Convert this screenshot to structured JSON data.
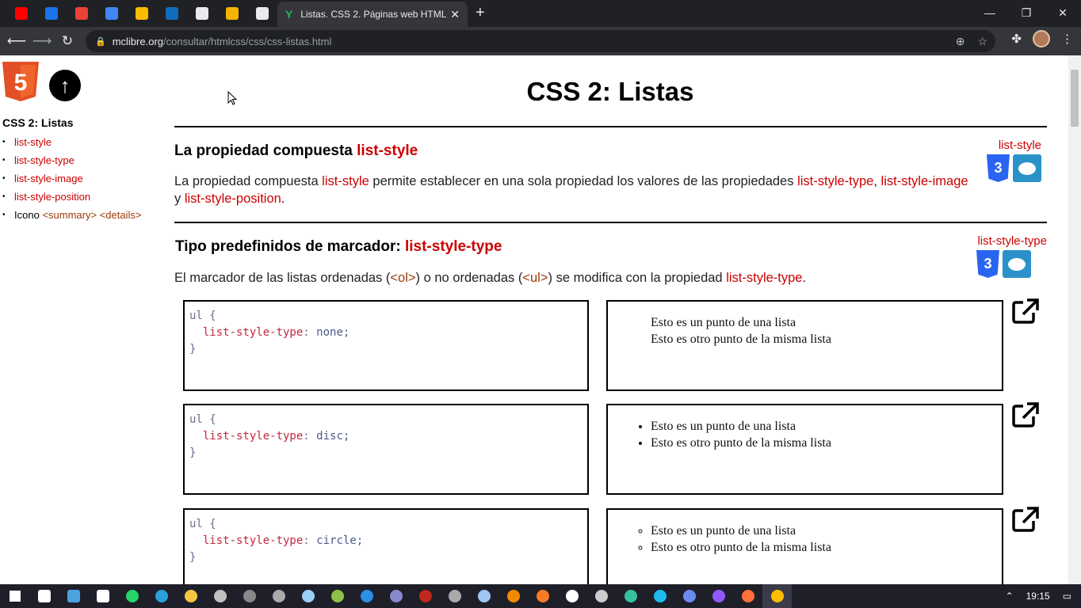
{
  "browser": {
    "pinned_tabs": [
      {
        "name": "youtube-tab",
        "color": "#ff0000"
      },
      {
        "name": "tab-app-2",
        "color": "#1a73e8"
      },
      {
        "name": "gmail-tab",
        "color": "#ea4335"
      },
      {
        "name": "calendar-tab",
        "color": "#4285f4"
      },
      {
        "name": "drive-tab",
        "color": "#fbbc04"
      },
      {
        "name": "mail-tab",
        "color": "#0f6cbd"
      },
      {
        "name": "tab-app-7",
        "color": "#e8eaed"
      },
      {
        "name": "tab-app-8",
        "color": "#f4b400"
      },
      {
        "name": "bookmark-tab",
        "color": "#e8eaed"
      }
    ],
    "active_tab_title": "Listas. CSS 2. Páginas web HTML",
    "active_tab_favicon": "Y",
    "url_domain": "mclibre.org",
    "url_path": "/consultar/htmlcss/css/css-listas.html"
  },
  "sidebar": {
    "title": "CSS 2: Listas",
    "items": [
      {
        "text": "list-style"
      },
      {
        "text": "list-style-type"
      },
      {
        "text": "list-style-image"
      },
      {
        "text": "list-style-position"
      },
      {
        "text": "Icono",
        "extra": "<summary> <details>"
      }
    ]
  },
  "main": {
    "title": "CSS 2: Listas",
    "section1": {
      "heading": "La propiedad compuesta ",
      "heading_code": "list-style",
      "badge": "list-style",
      "para_1": "La propiedad compuesta ",
      "para_code_1": "list-style",
      "para_2": " permite establecer en una sola propiedad los valores de las propiedades ",
      "para_code_2": "list-style-type",
      "para_3": ", ",
      "para_code_3": "list-style-image",
      "para_4": " y ",
      "para_code_4": "list-style-position",
      "para_5": "."
    },
    "section2": {
      "heading": "Tipo predefinidos de marcador: ",
      "heading_code": "list-style-type",
      "badge": "list-style-type",
      "para_1": "El marcador de las listas ordenadas (",
      "para_code_1": "<ol>",
      "para_2": ") o no ordenadas (",
      "para_code_2": "<ul>",
      "para_3": ") se modifica con la propiedad ",
      "para_code_3": "list-style-type",
      "para_4": "."
    },
    "examples": [
      {
        "selector": "ul {",
        "property": "list-style-type",
        "value": "none;",
        "close": "}",
        "style": "none",
        "items": [
          "Esto es un punto de una lista",
          "Esto es otro punto de la misma lista"
        ]
      },
      {
        "selector": "ul {",
        "property": "list-style-type",
        "value": "disc;",
        "close": "}",
        "style": "disc",
        "items": [
          "Esto es un punto de una lista",
          "Esto es otro punto de la misma lista"
        ]
      },
      {
        "selector": "ul {",
        "property": "list-style-type",
        "value": "circle;",
        "close": "}",
        "style": "circle",
        "items": [
          "Esto es un punto de una lista",
          "Esto es otro punto de la misma lista"
        ]
      }
    ]
  },
  "taskbar": {
    "time": "19:15",
    "apps": [
      {
        "name": "start-icon",
        "color": "#ffffff"
      },
      {
        "name": "taskview-icon",
        "color": "#ffffff"
      },
      {
        "name": "keyboard-app-icon",
        "color": "#4aa3df"
      },
      {
        "name": "app-icon",
        "color": "#ffffff"
      },
      {
        "name": "whatsapp-icon",
        "color": "#25d366"
      },
      {
        "name": "telegram-icon",
        "color": "#2aa1da"
      },
      {
        "name": "explorer-icon",
        "color": "#f5c542"
      },
      {
        "name": "app-icon",
        "color": "#c0c0c0"
      },
      {
        "name": "terminal-icon",
        "color": "#888888"
      },
      {
        "name": "app-icon",
        "color": "#aaaaaa"
      },
      {
        "name": "notepad-icon",
        "color": "#9ad0f5"
      },
      {
        "name": "notepadpp-icon",
        "color": "#8bc34a"
      },
      {
        "name": "vscode-icon",
        "color": "#2b8fe6"
      },
      {
        "name": "app-icon",
        "color": "#8888cc"
      },
      {
        "name": "filezilla-icon",
        "color": "#c0271e"
      },
      {
        "name": "app-icon",
        "color": "#aaaaaa"
      },
      {
        "name": "virtualbox-icon",
        "color": "#9fc6f0"
      },
      {
        "name": "vlc-icon",
        "color": "#f08a00"
      },
      {
        "name": "xampp-icon",
        "color": "#fb7a24"
      },
      {
        "name": "app-icon",
        "color": "#ffffff"
      },
      {
        "name": "app-icon",
        "color": "#cccccc"
      },
      {
        "name": "edge-icon",
        "color": "#35c1a0"
      },
      {
        "name": "ie-icon",
        "color": "#1ebbee"
      },
      {
        "name": "chromium-icon",
        "color": "#6a8cf0"
      },
      {
        "name": "firefox-dev-icon",
        "color": "#9059ff"
      },
      {
        "name": "firefox-icon",
        "color": "#ff7139"
      },
      {
        "name": "chrome-icon",
        "color": "#fbbc04"
      }
    ]
  }
}
